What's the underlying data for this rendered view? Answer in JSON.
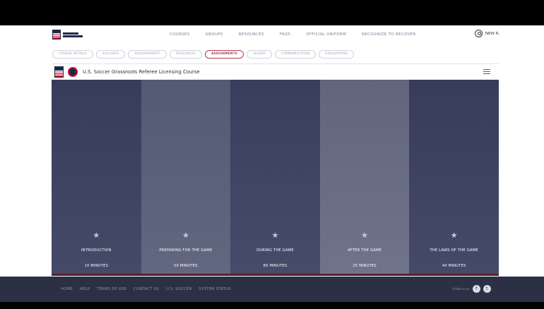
{
  "nav": {
    "items": [
      "COURSES",
      "GROUPS",
      "RESOURCES",
      "FAQS",
      "OFFICIAL UNIFORM",
      "RECOGNIZE TO RECOVER"
    ],
    "user_name": "NEW R."
  },
  "subtabs": [
    {
      "label": "COURSE DETAILS",
      "active": false
    },
    {
      "label": "SYLLABUS",
      "active": false
    },
    {
      "label": "REQUIREMENTS",
      "active": false
    },
    {
      "label": "RESOURCES",
      "active": false
    },
    {
      "label": "ASSIGNMENTS",
      "active": true
    },
    {
      "label": "LEADER",
      "active": false
    },
    {
      "label": "COMMUNICATION",
      "active": false
    },
    {
      "label": "EVALUATIONS",
      "active": false
    }
  ],
  "course": {
    "title": "U.S. Soccer Grassroots Referee Licensing Course"
  },
  "modules": [
    {
      "name": "INTRODUCTION",
      "duration": "10 MINUTES"
    },
    {
      "name": "PREPARING FOR THE GAME",
      "duration": "50 MINUTES"
    },
    {
      "name": "DURING THE GAME",
      "duration": "80 MINUTES"
    },
    {
      "name": "AFTER THE GAME",
      "duration": "25 MINUTES"
    },
    {
      "name": "THE LAWS OF THE GAME",
      "duration": "40 MINUTES"
    }
  ],
  "footer": {
    "links": [
      "HOME",
      "HELP",
      "TERMS OF USE",
      "CONTACT US",
      "U.S. SOCCER",
      "SYSTEM STATUS"
    ],
    "follow": "Follow us on",
    "icons": [
      "facebook-icon",
      "twitter-icon"
    ]
  },
  "colors": {
    "accent": "#b23a58",
    "footer": "#2b3045",
    "navy": "#1b2a4a"
  }
}
